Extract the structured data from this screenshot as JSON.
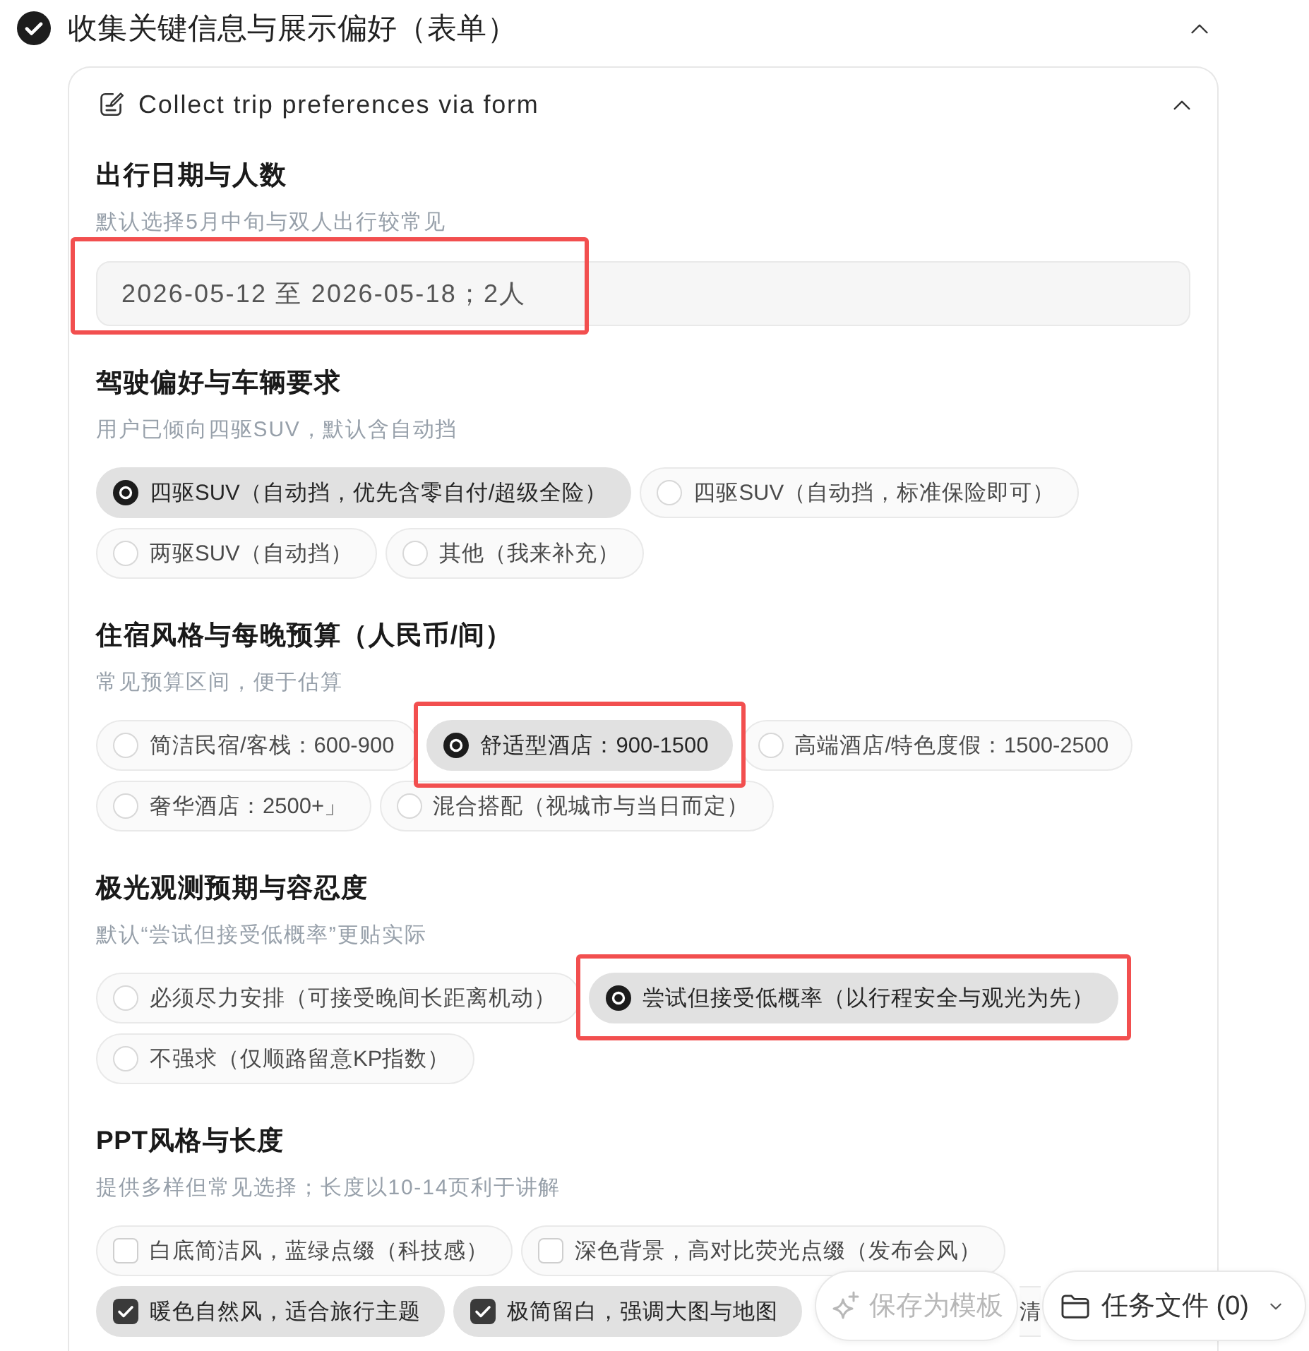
{
  "step": {
    "title": "收集关键信息与展示偏好（表单）",
    "done": true,
    "expanded": true
  },
  "card": {
    "title": "Collect trip preferences via form",
    "expanded": true,
    "sections": [
      {
        "kind": "text",
        "title": "出行日期与人数",
        "hint": "默认选择5月中旬与双人出行较常见",
        "value": "2026-05-12 至 2026-05-18；2人",
        "highlighted": true
      },
      {
        "kind": "single",
        "title": "驾驶偏好与车辆要求",
        "hint": "用户已倾向四驱SUV，默认含自动挡",
        "options": [
          {
            "label": "四驱SUV（自动挡，优先含零自付/超级全险）",
            "selected": true,
            "highlighted": false,
            "covered": false
          },
          {
            "label": "四驱SUV（自动挡，标准保险即可）",
            "selected": false,
            "highlighted": false,
            "covered": false
          },
          {
            "label": "两驱SUV（自动挡）",
            "selected": false,
            "highlighted": false,
            "covered": false
          },
          {
            "label": "其他（我来补充）",
            "selected": false,
            "highlighted": false,
            "covered": false
          }
        ]
      },
      {
        "kind": "single",
        "title": "住宿风格与每晚预算（人民币/间）",
        "hint": "常见预算区间，便于估算",
        "options": [
          {
            "label": "简洁民宿/客栈：600-900",
            "selected": false,
            "highlighted": false,
            "covered": false
          },
          {
            "label": "舒适型酒店：900-1500",
            "selected": true,
            "highlighted": true,
            "covered": false
          },
          {
            "label": "高端酒店/特色度假：1500-2500",
            "selected": false,
            "highlighted": false,
            "covered": false
          },
          {
            "label": "奢华酒店：2500+」",
            "selected": false,
            "highlighted": false,
            "covered": false
          },
          {
            "label": "混合搭配（视城市与当日而定）",
            "selected": false,
            "highlighted": false,
            "covered": false
          }
        ]
      },
      {
        "kind": "single",
        "title": "极光观测预期与容忍度",
        "hint": "默认“尝试但接受低概率”更贴实际",
        "options": [
          {
            "label": "必须尽力安排（可接受晚间长距离机动）",
            "selected": false,
            "highlighted": false,
            "covered": false
          },
          {
            "label": "尝试但接受低概率（以行程安全与观光为先）",
            "selected": true,
            "highlighted": true,
            "covered": false
          },
          {
            "label": "不强求（仅顺路留意KP指数）",
            "selected": false,
            "highlighted": false,
            "covered": false
          }
        ]
      },
      {
        "kind": "multi",
        "title": "PPT风格与长度",
        "hint": "提供多样但常见选择；长度以10-14页利于讲解",
        "options": [
          {
            "label": "白底简洁风，蓝绿点缀（科技感）",
            "checked": false,
            "highlighted": false,
            "covered": false
          },
          {
            "label": "深色背景，高对比荧光点缀（发布会风）",
            "checked": false,
            "highlighted": false,
            "covered": false
          },
          {
            "label": "暖色自然风，适合旅行主题",
            "checked": true,
            "highlighted": false,
            "covered": false
          },
          {
            "label": "极简留白，强调大图与地图",
            "checked": true,
            "highlighted": false,
            "covered": false
          },
          {
            "label": "清",
            "checked": false,
            "highlighted": false,
            "covered": true
          }
        ]
      }
    ]
  },
  "actions": {
    "save": {
      "label": "保存为模板",
      "disabled": true
    },
    "files": {
      "label": "任务文件 (0)"
    }
  }
}
